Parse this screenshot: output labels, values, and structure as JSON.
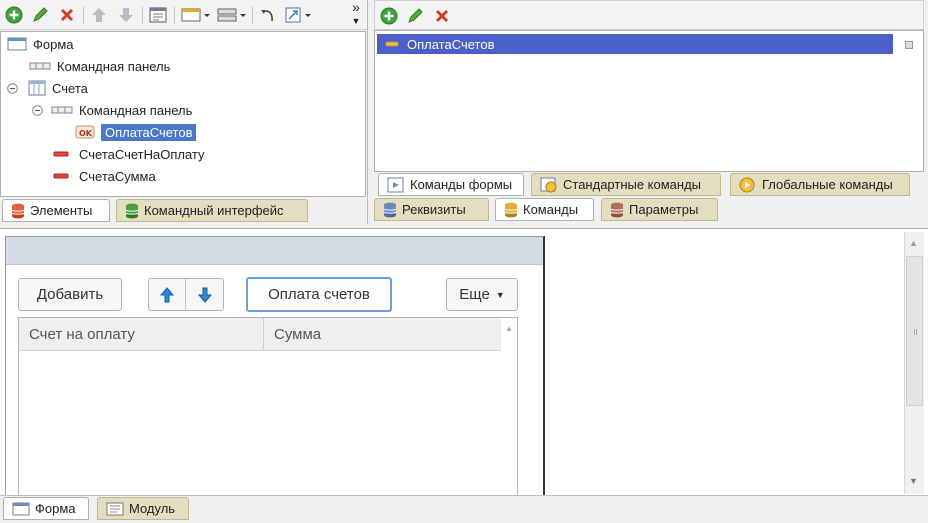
{
  "left_panel": {
    "toolbar": {
      "more_label": "»"
    },
    "tree": [
      {
        "label": "Форма"
      },
      {
        "label": "Командная панель"
      },
      {
        "label": "Счета"
      },
      {
        "label": "Командная панель"
      },
      {
        "label": "ОплатаСчетов",
        "badge": "OK"
      },
      {
        "label": "СчетаСчетНаОплату"
      },
      {
        "label": "СчетаСумма"
      }
    ],
    "tabs": [
      "Элементы",
      "Командный интерфейс"
    ]
  },
  "right_panel": {
    "commands": [
      "ОплатаСчетов"
    ],
    "command_tabs": [
      "Команды формы",
      "Стандартные команды",
      "Глобальные команды"
    ],
    "tabs": [
      "Реквизиты",
      "Команды",
      "Параметры"
    ]
  },
  "preview": {
    "buttons": {
      "add": "Добавить",
      "pay": "Оплата счетов",
      "more": "Еще"
    },
    "columns": [
      "Счет на оплату",
      "Сумма"
    ]
  },
  "bottom_tabs": [
    "Форма",
    "Модуль"
  ],
  "colors": {
    "selection": "#4b78c8",
    "command_selection": "#4b5fc8",
    "tab_inactive": "#e4ddc0",
    "form_header": "#d4dbe4"
  }
}
